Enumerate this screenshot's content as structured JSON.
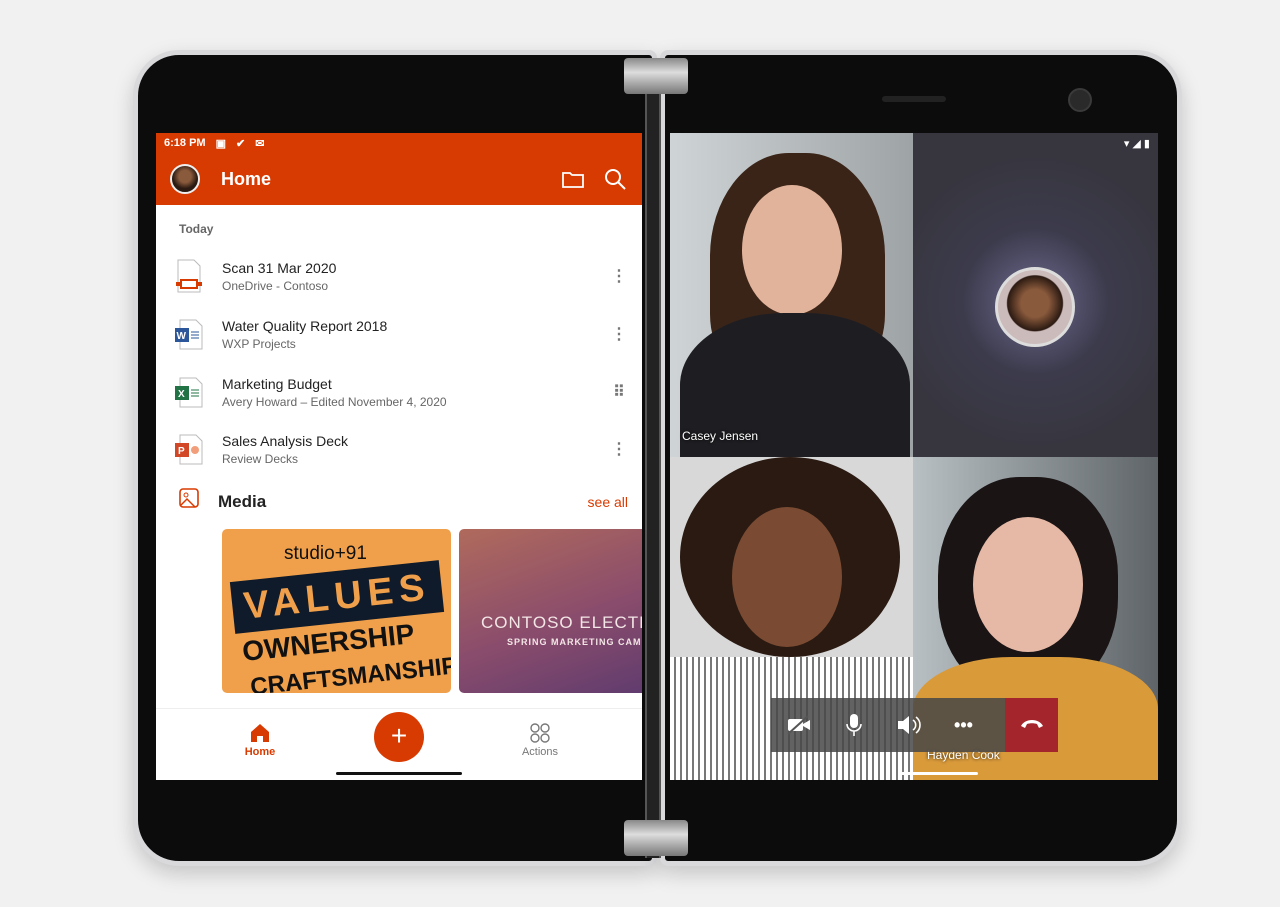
{
  "left_app": {
    "status": {
      "time": "6:18 PM",
      "icons": [
        "teams-icon",
        "check-icon",
        "outlook-icon"
      ]
    },
    "header": {
      "title": "Home",
      "icons": [
        "folder-icon",
        "search-icon"
      ]
    },
    "section_label": "Today",
    "files": [
      {
        "name": "Scan 31 Mar 2020",
        "location": "OneDrive - Contoso",
        "type": "scan",
        "accent": "#d83b01"
      },
      {
        "name": "Water Quality Report 2018",
        "location": "WXP Projects",
        "type": "word",
        "accent": "#2b579a"
      },
      {
        "name": "Marketing Budget",
        "location": "Avery Howard – Edited November 4, 2020",
        "type": "excel",
        "accent": "#217346"
      },
      {
        "name": "Sales Analysis Deck",
        "location": "Review Decks",
        "type": "powerpoint",
        "accent": "#d24726"
      }
    ],
    "media": {
      "title": "Media",
      "see_all": "see all",
      "thumbs": [
        {
          "lines": [
            "studio+91",
            "VALUES",
            "OWNERSHIP",
            "CRAFTSMANSHIP"
          ]
        },
        {
          "lines": [
            "CONTOSO ELECTR",
            "SPRING MARKETING CAM"
          ]
        }
      ]
    },
    "nav": {
      "home": "Home",
      "actions": "Actions",
      "fab": "+"
    },
    "accent": "#d83b01"
  },
  "call": {
    "participants": [
      {
        "name": "Casey Jensen"
      },
      {
        "name": ""
      },
      {
        "name": ""
      },
      {
        "name": "Hayden Cook"
      }
    ],
    "controls": [
      "camera-off-icon",
      "microphone-icon",
      "speaker-icon",
      "more-icon",
      "end-call-icon"
    ],
    "end_call_color": "#a4262c"
  }
}
